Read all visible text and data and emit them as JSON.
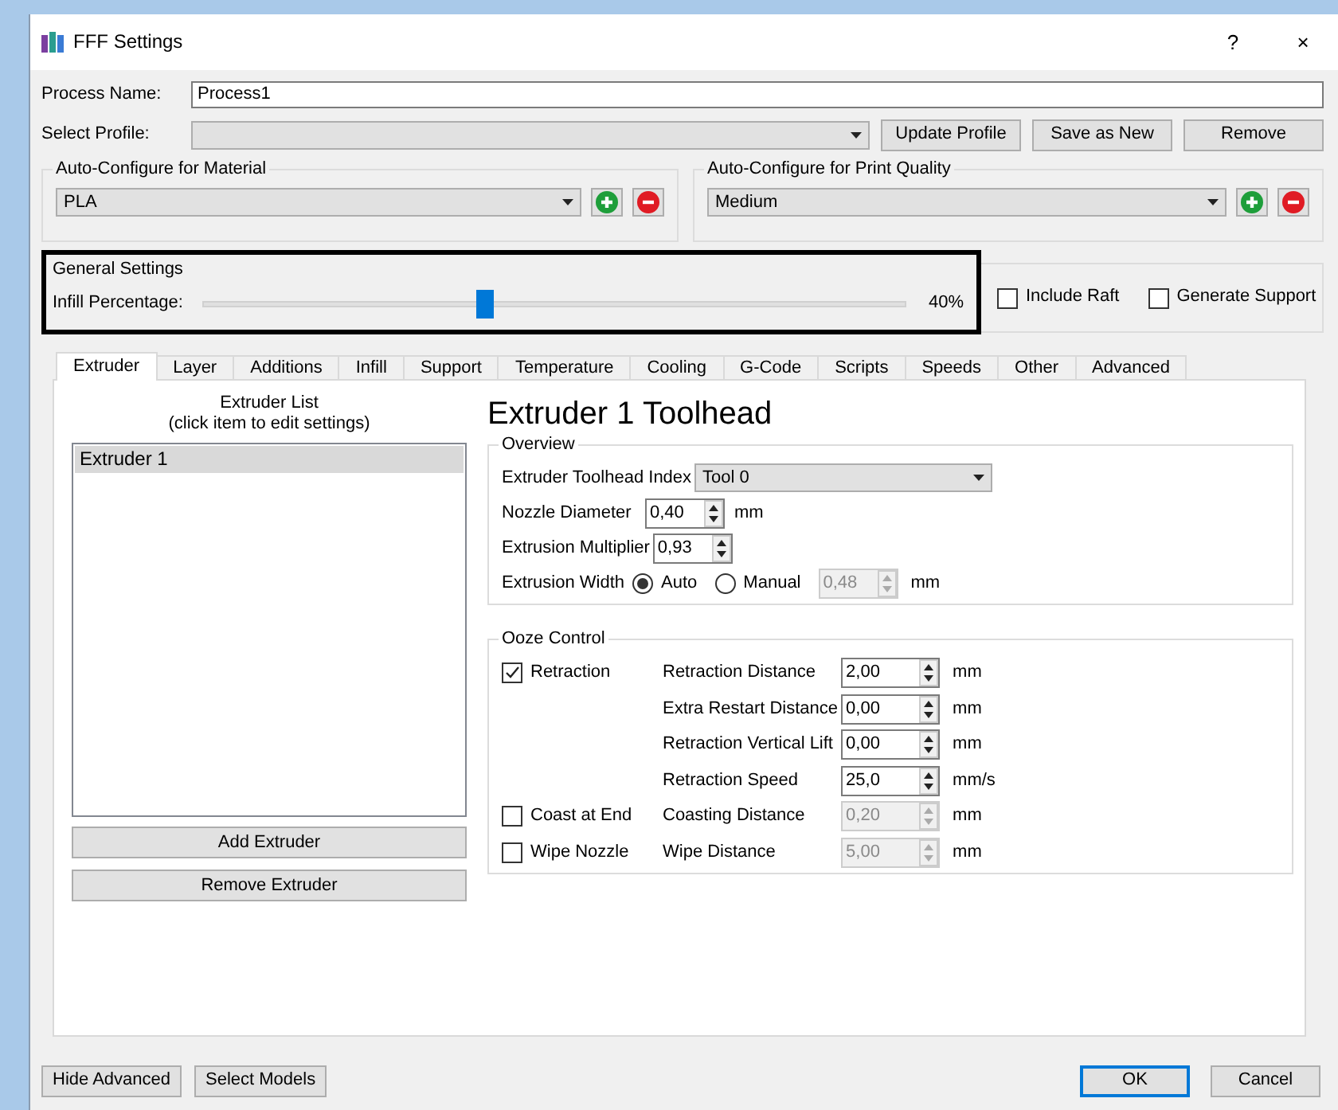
{
  "window": {
    "title": "FFF Settings",
    "help": "?",
    "close": "×"
  },
  "process_name": {
    "label": "Process Name:",
    "value": "Process1"
  },
  "select_profile": {
    "label": "Select Profile:",
    "buttons": [
      "Update Profile",
      "Save as New",
      "Remove"
    ]
  },
  "auto_configure": [
    {
      "title": "Auto-Configure for Material",
      "value": "PLA"
    },
    {
      "title": "Auto-Configure for Print Quality",
      "value": "Medium"
    }
  ],
  "general_settings": {
    "title": "General Settings",
    "highlighted": true,
    "infill": {
      "label": "Infill Percentage:",
      "level": 0.4,
      "reading": "40%"
    },
    "options": [
      {
        "label": "Include Raft",
        "checked": false
      },
      {
        "label": "Generate Support",
        "checked": false
      }
    ]
  },
  "tabs": [
    {
      "label": "Extruder",
      "selected": true
    },
    {
      "label": "Layer",
      "selected": false
    },
    {
      "label": "Additions",
      "selected": false
    },
    {
      "label": "Infill",
      "selected": false
    },
    {
      "label": "Support",
      "selected": false
    },
    {
      "label": "Temperature",
      "selected": false
    },
    {
      "label": "Cooling",
      "selected": false
    },
    {
      "label": "G-Code",
      "selected": false
    },
    {
      "label": "Scripts",
      "selected": false
    },
    {
      "label": "Speeds",
      "selected": false
    },
    {
      "label": "Other",
      "selected": false
    },
    {
      "label": "Advanced",
      "selected": false
    }
  ],
  "extruder_list": {
    "title": "Extruder List",
    "subtitle": "(click item to edit settings)",
    "items": [
      {
        "label": "Extruder 1",
        "selected": true
      }
    ],
    "buttons": [
      "Add Extruder",
      "Remove Extruder"
    ]
  },
  "toolhead": {
    "heading": "Extruder 1 Toolhead",
    "overview": {
      "title": "Overview",
      "index": {
        "label": "Extruder Toolhead Index",
        "value": "Tool 0"
      },
      "nozzle": {
        "label": "Nozzle Diameter",
        "value": "0,40",
        "unit": "mm"
      },
      "multiplier": {
        "label": "Extrusion Multiplier",
        "value": "0,93"
      },
      "width": {
        "label": "Extrusion Width",
        "options": [
          {
            "label": "Auto",
            "selected": true
          },
          {
            "label": "Manual",
            "selected": false
          }
        ],
        "value": "0,48",
        "unit": "mm",
        "disabled": true
      }
    },
    "ooze": {
      "title": "Ooze Control",
      "rows": [
        {
          "check": {
            "label": "Retraction",
            "checked": true
          },
          "label": "Retraction Distance",
          "value": "2,00",
          "unit": "mm",
          "disabled": false
        },
        {
          "label": "Extra Restart Distance",
          "value": "0,00",
          "unit": "mm",
          "disabled": false
        },
        {
          "label": "Retraction Vertical Lift",
          "value": "0,00",
          "unit": "mm",
          "disabled": false
        },
        {
          "label": "Retraction Speed",
          "value": "25,0",
          "unit": "mm/s",
          "disabled": false
        },
        {
          "check": {
            "label": "Coast at End",
            "checked": false
          },
          "label": "Coasting Distance",
          "value": "0,20",
          "unit": "mm",
          "disabled": true
        },
        {
          "check": {
            "label": "Wipe Nozzle",
            "checked": false
          },
          "label": "Wipe Distance",
          "value": "5,00",
          "unit": "mm",
          "disabled": true
        }
      ]
    }
  },
  "footer": {
    "left": [
      "Hide Advanced",
      "Select Models"
    ],
    "right": [
      {
        "label": "OK",
        "default": true
      },
      {
        "label": "Cancel",
        "default": false
      }
    ]
  }
}
